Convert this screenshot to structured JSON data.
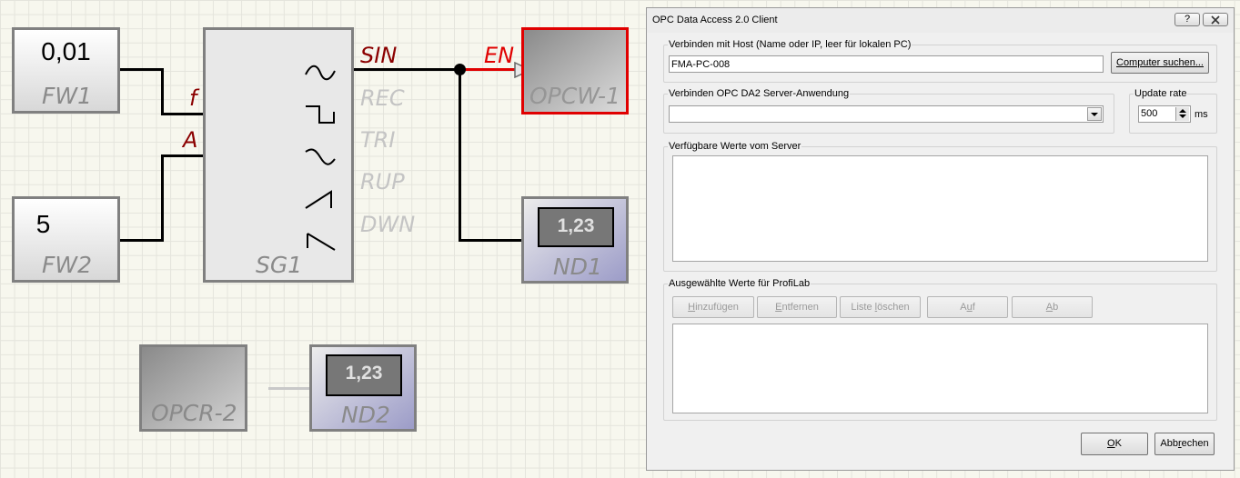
{
  "diagram": {
    "fw1": {
      "value": "0,01",
      "label": "FW1"
    },
    "fw2": {
      "value": "5",
      "label": "FW2"
    },
    "sg1": {
      "label": "SG1",
      "inputs": [
        "f",
        "A"
      ],
      "outputs": [
        {
          "name": "SIN",
          "wave": "sine-wave-icon"
        },
        {
          "name": "REC",
          "wave": "square-wave-icon"
        },
        {
          "name": "TRI",
          "wave": "triangle-wave-icon"
        },
        {
          "name": "RUP",
          "wave": "ramp-up-icon"
        },
        {
          "name": "DWN",
          "wave": "ramp-down-icon"
        }
      ]
    },
    "opcw1": {
      "label": "OPCW-1",
      "input": "EN"
    },
    "nd1": {
      "label": "ND1",
      "display": "1,23"
    },
    "opcr2": {
      "label": "OPCR-2"
    },
    "nd2": {
      "label": "ND2",
      "display": "1,23"
    },
    "colors": {
      "active_wire": "#000000",
      "enable_wire": "#e00000",
      "active_port": "#8b0000",
      "inactive_port": "#c4c4c4"
    }
  },
  "dialog": {
    "title": "OPC Data Access 2.0 Client",
    "help_button": "?",
    "close_icon": "close-icon",
    "host_group": {
      "legend": "Verbinden mit Host (Name oder IP, leer für lokalen PC)",
      "host_value": "FMA-PC-008",
      "search_button": "Computer suchen..."
    },
    "server_group": {
      "legend": "Verbinden OPC DA2 Server-Anwendung",
      "selected": ""
    },
    "update_group": {
      "legend": "Update rate",
      "value": "500",
      "unit": "ms"
    },
    "available_group": {
      "legend": "Verfügbare Werte vom Server"
    },
    "selected_group": {
      "legend": "Ausgewählte Werte für ProfiLab",
      "buttons": {
        "add": {
          "pre": "",
          "key": "H",
          "post": "inzufügen"
        },
        "remove": {
          "pre": "",
          "key": "E",
          "post": "ntfernen"
        },
        "clear": {
          "pre": "Liste ",
          "key": "l",
          "post": "öschen"
        },
        "up": {
          "pre": "A",
          "key": "u",
          "post": "f"
        },
        "down": {
          "pre": "",
          "key": "A",
          "post": "b"
        }
      }
    },
    "ok": {
      "pre": "",
      "key": "O",
      "post": "K"
    },
    "cancel": {
      "pre": "Abb",
      "key": "r",
      "post": "echen"
    }
  }
}
